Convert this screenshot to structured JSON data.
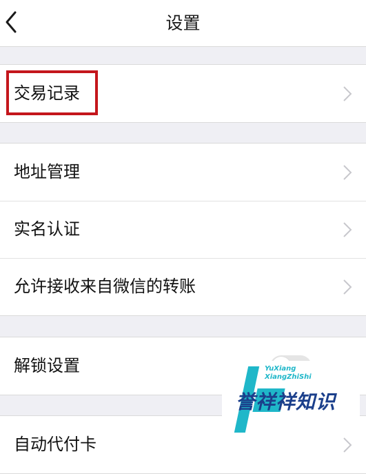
{
  "header": {
    "title": "设置"
  },
  "groups": [
    {
      "items": [
        {
          "label": "交易记录",
          "highlighted": true
        }
      ]
    },
    {
      "items": [
        {
          "label": "地址管理"
        },
        {
          "label": "实名认证"
        },
        {
          "label": "允许接收来自微信的转账"
        }
      ]
    },
    {
      "items": [
        {
          "label": "解锁设置",
          "has_toggle": true
        }
      ]
    },
    {
      "items": [
        {
          "label": "自动代付卡"
        }
      ]
    }
  ],
  "watermark": {
    "latin": "YuXiang XiangZhiShi",
    "cn": "誉祥祥知识"
  },
  "colors": {
    "highlight": "#c4161c",
    "background": "#efeff4",
    "chevron": "#c7c7cc",
    "watermark_cyan": "#1fb7c9",
    "watermark_navy": "#1b3f8b"
  },
  "icons": {
    "back": "chevron-left-icon",
    "row_arrow": "chevron-right-icon"
  }
}
